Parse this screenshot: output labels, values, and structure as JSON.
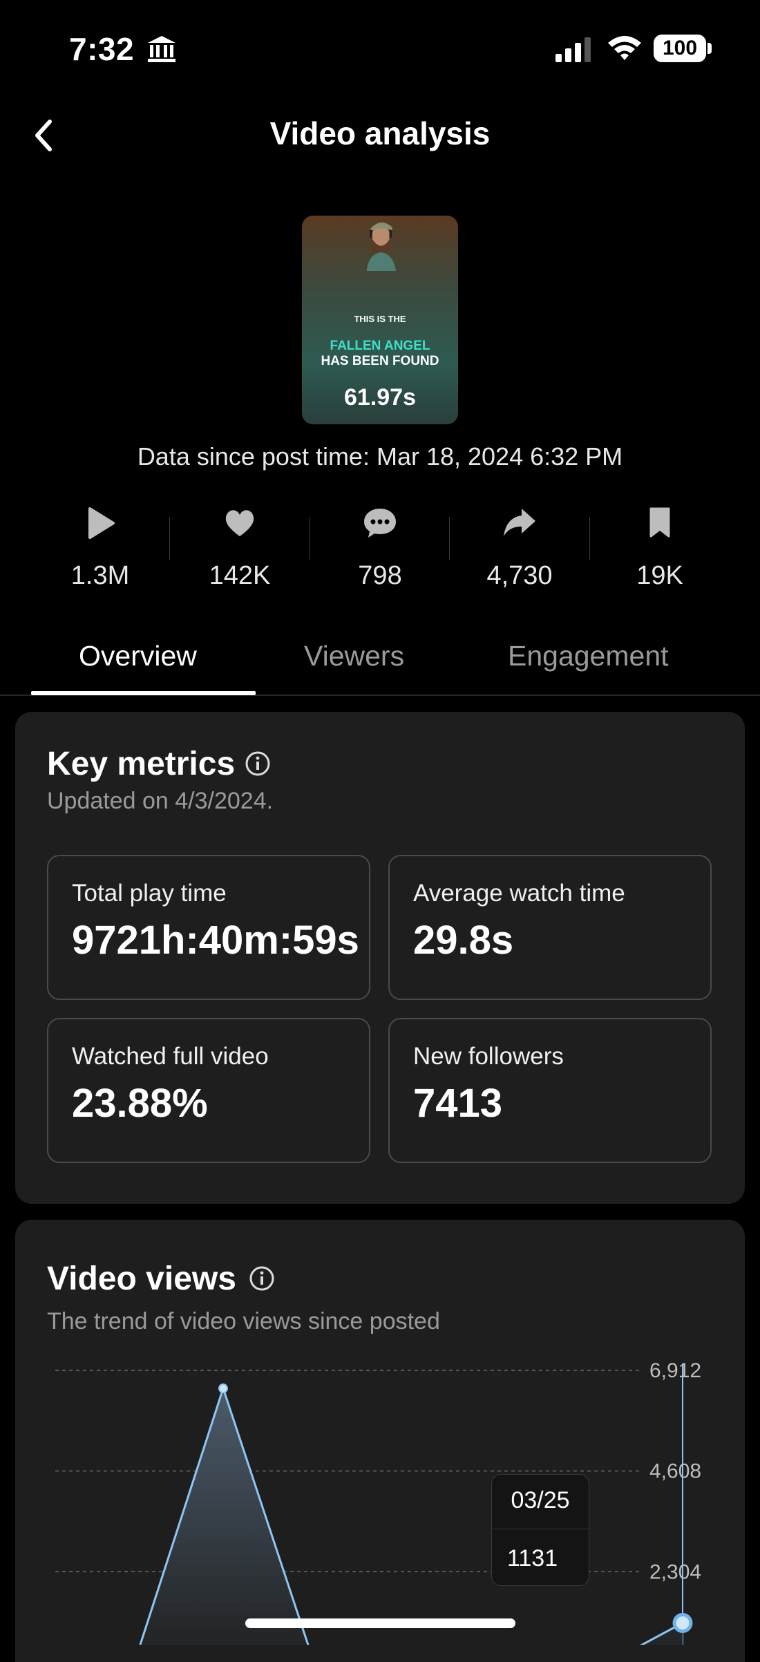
{
  "status_bar": {
    "time": "7:32",
    "battery": "100"
  },
  "header": {
    "title": "Video analysis"
  },
  "video": {
    "thumbnail_text": [
      "THIS IS THE",
      "FALLEN ANGEL",
      "HAS BEEN FOUND"
    ],
    "duration": "61.97s",
    "data_since": "Data since post time: Mar 18, 2024 6:32 PM"
  },
  "stats": [
    {
      "icon": "play-icon",
      "value": "1.3M"
    },
    {
      "icon": "heart-icon",
      "value": "142K"
    },
    {
      "icon": "comment-icon",
      "value": "798"
    },
    {
      "icon": "share-icon",
      "value": "4,730"
    },
    {
      "icon": "bookmark-icon",
      "value": "19K"
    }
  ],
  "tabs": [
    {
      "label": "Overview",
      "active": true
    },
    {
      "label": "Viewers",
      "active": false
    },
    {
      "label": "Engagement",
      "active": false
    }
  ],
  "key_metrics": {
    "title": "Key metrics",
    "updated": "Updated on 4/3/2024.",
    "items": [
      {
        "label": "Total play time",
        "value": "9721h:40m:59s"
      },
      {
        "label": "Average watch time",
        "value": "29.8s"
      },
      {
        "label": "Watched full video",
        "value": "23.88%"
      },
      {
        "label": "New followers",
        "value": "7413"
      }
    ]
  },
  "video_views": {
    "title": "Video views",
    "subtitle": "The trend of video views since posted"
  },
  "chart_data": {
    "type": "area",
    "title": "Video views",
    "y_ticks": [
      "6,912",
      "4,608",
      "2,304"
    ],
    "ylim": [
      0,
      6912
    ],
    "grid": true,
    "series": [
      {
        "points": [
          {
            "x": 0,
            "y": 0
          },
          {
            "x": 1,
            "y": 6500
          },
          {
            "x": 2,
            "y": 150
          },
          {
            "x": 3,
            "y": 0
          },
          {
            "x": 5,
            "y": 0
          },
          {
            "x": 6,
            "y": 1131
          }
        ]
      }
    ],
    "tooltip": {
      "date": "03/25",
      "value": "1131"
    },
    "colors": {
      "line": "#8ec5f2",
      "fill_top": "#4b5b6a",
      "fill_bottom": "#1e1e1e"
    }
  }
}
